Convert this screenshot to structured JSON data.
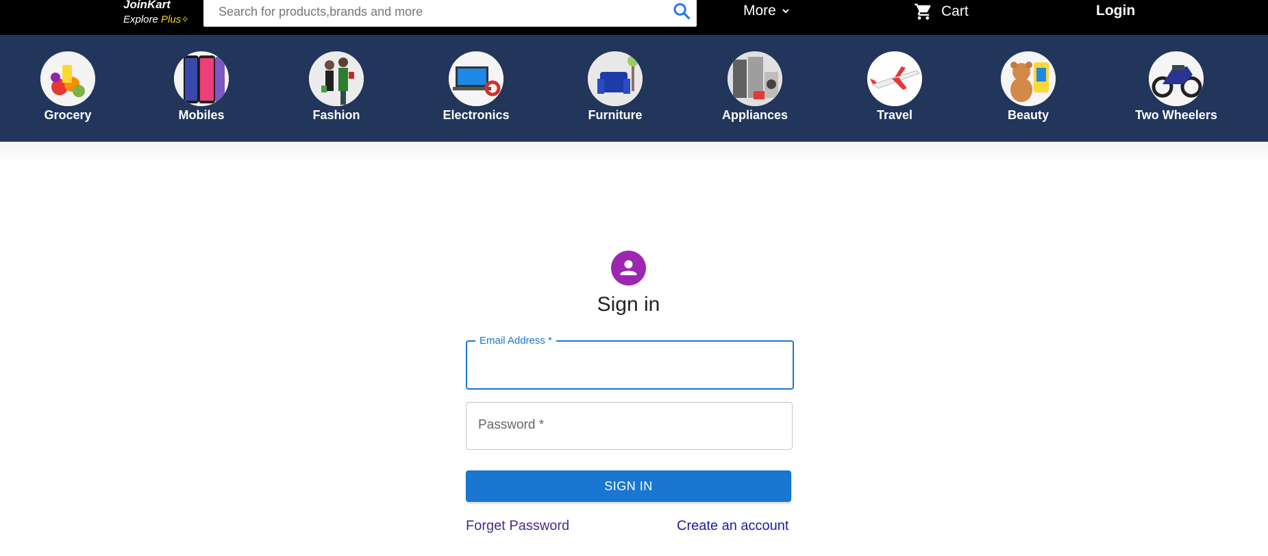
{
  "header": {
    "brand_name": "JoinKart",
    "brand_tag_prefix": "Explore ",
    "brand_tag_plus": "Plus",
    "search_placeholder": "Search for products,brands and more",
    "more_label": "More",
    "cart_label": "Cart",
    "login_label": "Login"
  },
  "categories": [
    {
      "label": "Grocery",
      "icon": "grocery-image"
    },
    {
      "label": "Mobiles",
      "icon": "mobiles-image"
    },
    {
      "label": "Fashion",
      "icon": "fashion-image"
    },
    {
      "label": "Electronics",
      "icon": "electronics-image"
    },
    {
      "label": "Furniture",
      "icon": "furniture-image"
    },
    {
      "label": "Appliances",
      "icon": "appliances-image"
    },
    {
      "label": "Travel",
      "icon": "travel-image"
    },
    {
      "label": "Beauty",
      "icon": "beauty-image"
    },
    {
      "label": "Two Wheelers",
      "icon": "two-wheelers-image"
    }
  ],
  "signin": {
    "title": "Sign in",
    "email_label": "Email Address *",
    "email_value": "",
    "password_placeholder": "Password *",
    "button_label": "SIGN IN",
    "forget_label": "Forget Password",
    "create_label": "Create an account"
  },
  "colors": {
    "topbar": "#000000",
    "category_bar": "#22355a",
    "primary": "#1976d2",
    "avatar": "#9c27b0",
    "brand_accent": "#ffd11a"
  }
}
